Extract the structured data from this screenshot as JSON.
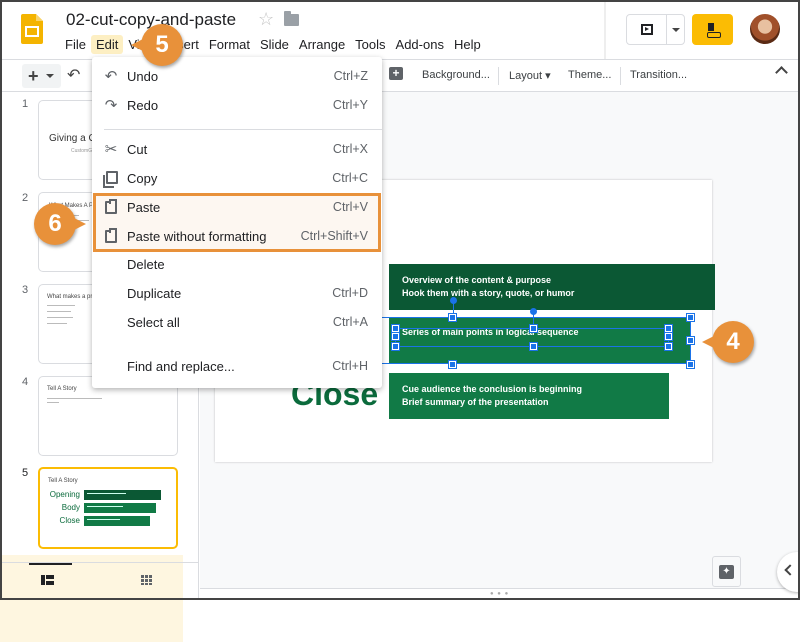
{
  "header": {
    "doc_title": "02-cut-copy-and-paste",
    "menus": [
      "File",
      "Edit",
      "View",
      "Insert",
      "Format",
      "Slide",
      "Arrange",
      "Tools",
      "Add-ons",
      "Help"
    ],
    "active_menu": "Edit"
  },
  "toolbar": {
    "background": "Background...",
    "layout": "Layout",
    "theme": "Theme...",
    "transition": "Transition..."
  },
  "filmstrip": {
    "slides": [
      {
        "num": "1",
        "title": "Giving a Great Presentation",
        "subtitle": "CustomGuide"
      },
      {
        "num": "2",
        "title": "What Makes A Presentation"
      },
      {
        "num": "3",
        "title": "What makes a presentation"
      },
      {
        "num": "4",
        "title": "Tell A Story"
      },
      {
        "num": "5",
        "title": "Tell A Story",
        "labels": [
          "Opening",
          "Body",
          "Close"
        ]
      }
    ],
    "selected": "5"
  },
  "slide": {
    "sections": {
      "close_label": "Close"
    },
    "boxes": {
      "opening": [
        "Overview of the content & purpose",
        "Hook them with a story, quote, or humor"
      ],
      "body": [
        "Series of main points in logical sequence"
      ],
      "close": [
        "Cue audience the conclusion is beginning",
        "Brief summary of the presentation"
      ]
    }
  },
  "edit_menu": {
    "items": [
      {
        "label": "Undo",
        "shortcut": "Ctrl+Z",
        "icon": "undo-icon"
      },
      {
        "label": "Redo",
        "shortcut": "Ctrl+Y",
        "icon": "redo-icon"
      },
      {
        "label": "Cut",
        "shortcut": "Ctrl+X",
        "icon": "scissors-icon"
      },
      {
        "label": "Copy",
        "shortcut": "Ctrl+C",
        "icon": "copy-icon"
      },
      {
        "label": "Paste",
        "shortcut": "Ctrl+V",
        "icon": "clipboard-icon"
      },
      {
        "label": "Paste without formatting",
        "shortcut": "Ctrl+Shift+V",
        "icon": "clipboard-text-icon"
      },
      {
        "label": "Delete",
        "shortcut": ""
      },
      {
        "label": "Duplicate",
        "shortcut": "Ctrl+D"
      },
      {
        "label": "Select all",
        "shortcut": "Ctrl+A"
      },
      {
        "label": "Find and replace...",
        "shortcut": "Ctrl+H"
      }
    ]
  },
  "callouts": {
    "step4": "4",
    "step5": "5",
    "step6": "6"
  },
  "colors": {
    "accent_orange": "#e8913a",
    "green_dark": "#0b5834",
    "green": "#117a46",
    "selection_blue": "#1a73e8",
    "share_yellow": "#fbbc04"
  }
}
